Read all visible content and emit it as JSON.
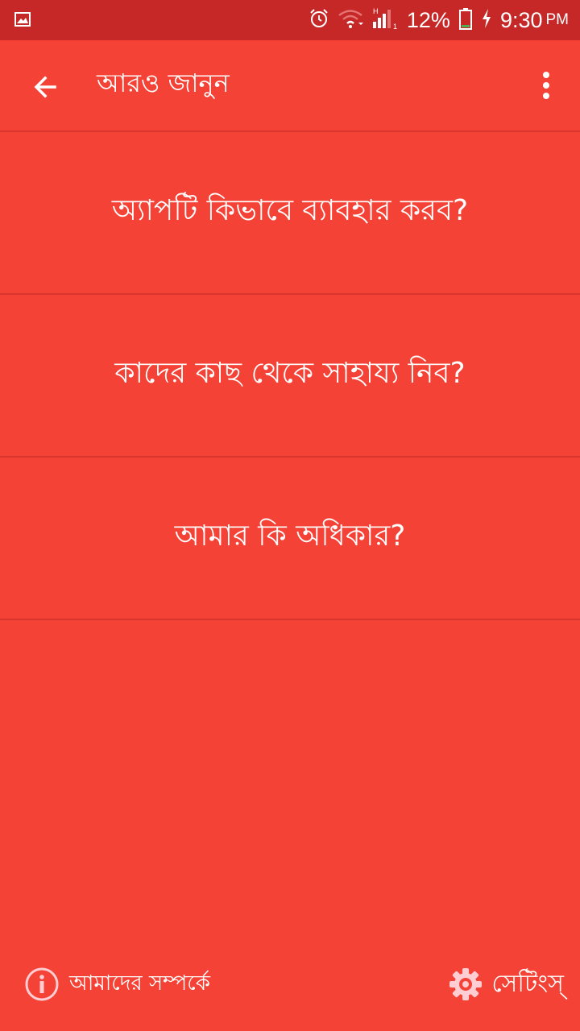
{
  "status_bar": {
    "battery": "12%",
    "time": "9:30",
    "ampm": "PM",
    "icons": [
      "image-icon",
      "alarm-icon",
      "wifi-icon",
      "signal-icon",
      "battery-icon",
      "charging-icon"
    ]
  },
  "app_bar": {
    "title": "আরও জানুন",
    "back_icon": "arrow-left-icon",
    "overflow_icon": "more-vert-icon"
  },
  "menu": {
    "items": [
      {
        "label": "অ্যাপটি কিভাবে ব্যাবহার করব?"
      },
      {
        "label": "কাদের কাছ থেকে সাহায্য নিব?"
      },
      {
        "label": "আমার কি অধিকার?"
      }
    ]
  },
  "footer": {
    "about_label": "আমাদের সম্পর্কে",
    "about_icon": "info-icon",
    "settings_label": "সেটিংস্",
    "settings_icon": "gear-icon"
  },
  "colors": {
    "primary": "#F44336",
    "status_bar": "#C62828",
    "divider": "#D8352C",
    "text": "#FFFFFF"
  }
}
